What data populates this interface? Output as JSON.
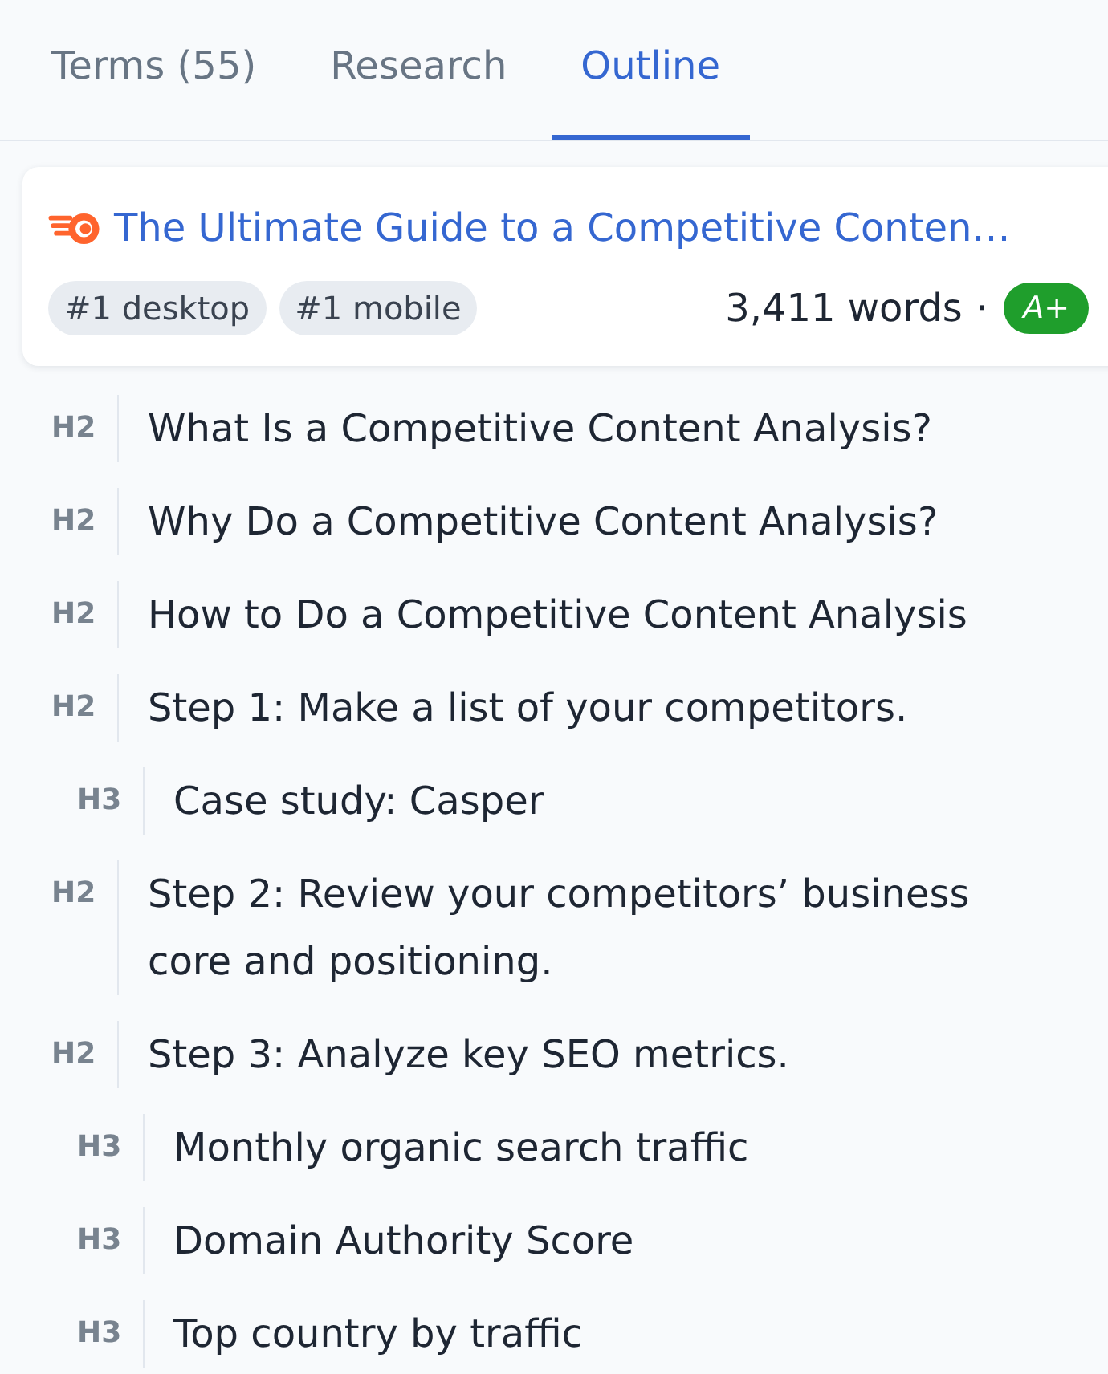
{
  "tabs": [
    {
      "label": "Terms (55)",
      "selected": false
    },
    {
      "label": "Research",
      "selected": false
    },
    {
      "label": "Outline",
      "selected": true
    }
  ],
  "result_card": {
    "title": "The Ultimate Guide to a Competitive Conten…",
    "tags": [
      "#1 desktop",
      "#1 mobile"
    ],
    "word_count": "3,411 words",
    "separator": "·",
    "grade": "A+"
  },
  "outline": [
    {
      "level": "H2",
      "text": "What Is a Competitive Content Analysis?"
    },
    {
      "level": "H2",
      "text": "Why Do a Competitive Content Analysis?"
    },
    {
      "level": "H2",
      "text": "How to Do a Competitive Content Analysis"
    },
    {
      "level": "H2",
      "text": "Step 1: Make a list of your competitors.",
      "children": [
        {
          "level": "H3",
          "text": "Case study: Casper"
        }
      ]
    },
    {
      "level": "H2",
      "text": "Step 2: Review your competitors’ business core and positioning."
    },
    {
      "level": "H2",
      "text": "Step 3: Analyze key SEO metrics.",
      "children": [
        {
          "level": "H3",
          "text": "Monthly organic search traffic"
        },
        {
          "level": "H3",
          "text": "Domain Authority Score"
        },
        {
          "level": "H3",
          "text": "Top country by traffic"
        }
      ]
    }
  ]
}
